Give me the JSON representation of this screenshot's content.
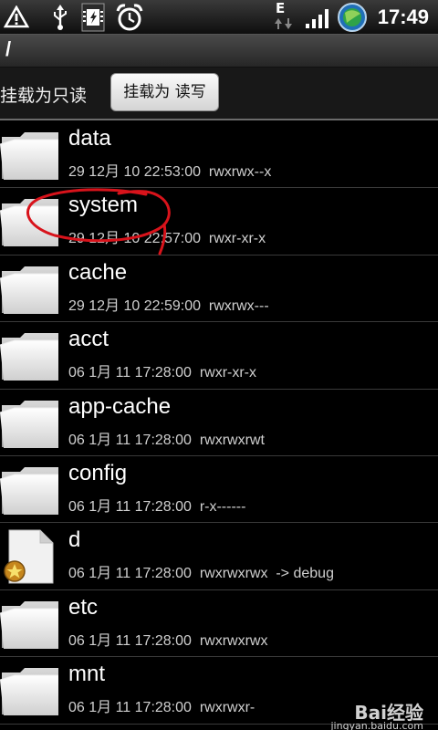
{
  "status_bar": {
    "network_label": "E",
    "time": "17:49",
    "icons": [
      "warning-icon",
      "usb-icon",
      "debug-icon",
      "alarm-icon",
      "data-activity-icon",
      "signal-icon",
      "gps-icon"
    ]
  },
  "path": {
    "text": "/"
  },
  "mount": {
    "label": "挂载为只读",
    "button_label": "挂载为 读写"
  },
  "files": [
    {
      "name": "data",
      "meta": "29 12月 10 22:53:00  rwxrwx--x",
      "icon": "folder-icon"
    },
    {
      "name": "system",
      "meta": "29 12月 10 22:57:00  rwxr-xr-x",
      "icon": "folder-icon"
    },
    {
      "name": "cache",
      "meta": "29 12月 10 22:59:00  rwxrwx---",
      "icon": "folder-icon"
    },
    {
      "name": "acct",
      "meta": "06 1月 11 17:28:00  rwxr-xr-x",
      "icon": "folder-icon"
    },
    {
      "name": "app-cache",
      "meta": "06 1月 11 17:28:00  rwxrwxrwt",
      "icon": "folder-icon"
    },
    {
      "name": "config",
      "meta": "06 1月 11 17:28:00  r-x------",
      "icon": "folder-icon"
    },
    {
      "name": "d",
      "meta": "06 1月 11 17:28:00  rwxrwxrwx  -> debug",
      "icon": "symlink-file-icon"
    },
    {
      "name": "etc",
      "meta": "06 1月 11 17:28:00  rwxrwxrwx",
      "icon": "folder-icon"
    },
    {
      "name": "mnt",
      "meta": "06 1月 11 17:28:00  rwxrwxr-",
      "icon": "folder-icon"
    }
  ],
  "watermark": {
    "brand": "Bai经验",
    "url": "jingyan.baidu.com"
  },
  "colors": {
    "annotation": "#d8131b",
    "background": "#000000",
    "button_bg": "#e8e8e8"
  }
}
